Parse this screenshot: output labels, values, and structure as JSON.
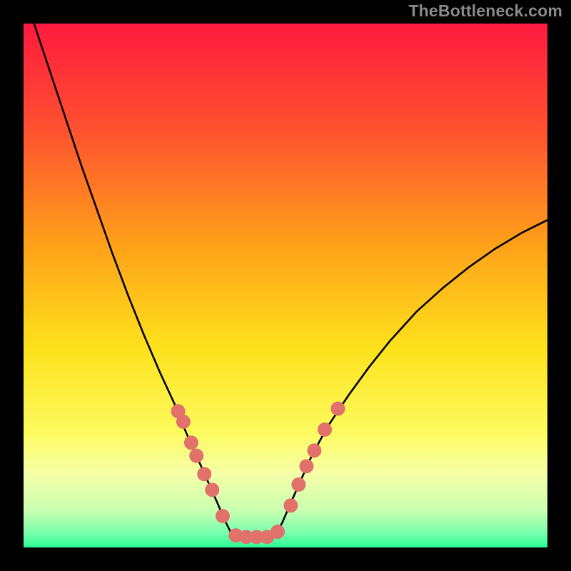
{
  "watermark": "TheBottleneck.com",
  "chart_data": {
    "type": "line",
    "title": "",
    "xlabel": "",
    "ylabel": "",
    "xlim": [
      0,
      100
    ],
    "ylim": [
      0,
      100
    ],
    "background_gradient": {
      "stops": [
        {
          "offset": 0.0,
          "color": "#ff1a3f"
        },
        {
          "offset": 0.2,
          "color": "#ff5030"
        },
        {
          "offset": 0.42,
          "color": "#ffa019"
        },
        {
          "offset": 0.62,
          "color": "#fde21c"
        },
        {
          "offset": 0.78,
          "color": "#fdfb5f"
        },
        {
          "offset": 0.86,
          "color": "#f5ffa8"
        },
        {
          "offset": 0.93,
          "color": "#c9ffb0"
        },
        {
          "offset": 0.97,
          "color": "#7dffad"
        },
        {
          "offset": 1.0,
          "color": "#2bfc96"
        }
      ]
    },
    "series": [
      {
        "name": "left-curve",
        "x": [
          2.0,
          5.0,
          8.0,
          11.0,
          14.0,
          17.0,
          20.0,
          23.0,
          26.0,
          29.0,
          31.0,
          33.0,
          35.0,
          37.0,
          38.5,
          40.0
        ],
        "y": [
          100.0,
          91.0,
          82.0,
          73.0,
          64.5,
          56.0,
          48.0,
          40.5,
          33.5,
          27.0,
          22.0,
          17.5,
          13.0,
          8.5,
          5.0,
          2.0
        ]
      },
      {
        "name": "right-curve",
        "x": [
          48.0,
          49.5,
          51.0,
          53.0,
          55.0,
          58.0,
          62.0,
          66.0,
          70.0,
          75.0,
          80.0,
          85.0,
          90.0,
          95.0,
          100.0
        ],
        "y": [
          2.0,
          5.0,
          8.5,
          13.0,
          17.5,
          23.0,
          29.0,
          34.5,
          39.5,
          45.0,
          49.5,
          53.5,
          57.0,
          60.0,
          62.5
        ]
      },
      {
        "name": "floor",
        "x": [
          40.0,
          48.0
        ],
        "y": [
          2.0,
          2.0
        ]
      }
    ],
    "dots": {
      "name": "highlight-dots",
      "color": "#e0716b",
      "radius_px": 10,
      "points": [
        {
          "x": 29.5,
          "y": 26.0
        },
        {
          "x": 30.5,
          "y": 24.0
        },
        {
          "x": 32.0,
          "y": 20.0
        },
        {
          "x": 33.0,
          "y": 17.5
        },
        {
          "x": 34.5,
          "y": 14.0
        },
        {
          "x": 36.0,
          "y": 11.0
        },
        {
          "x": 38.0,
          "y": 6.0
        },
        {
          "x": 40.5,
          "y": 2.3
        },
        {
          "x": 42.5,
          "y": 2.0
        },
        {
          "x": 44.5,
          "y": 2.0
        },
        {
          "x": 46.5,
          "y": 2.0
        },
        {
          "x": 48.5,
          "y": 3.0
        },
        {
          "x": 51.0,
          "y": 8.0
        },
        {
          "x": 52.5,
          "y": 12.0
        },
        {
          "x": 54.0,
          "y": 15.5
        },
        {
          "x": 55.5,
          "y": 18.5
        },
        {
          "x": 57.5,
          "y": 22.5
        },
        {
          "x": 60.0,
          "y": 26.5
        }
      ]
    }
  }
}
